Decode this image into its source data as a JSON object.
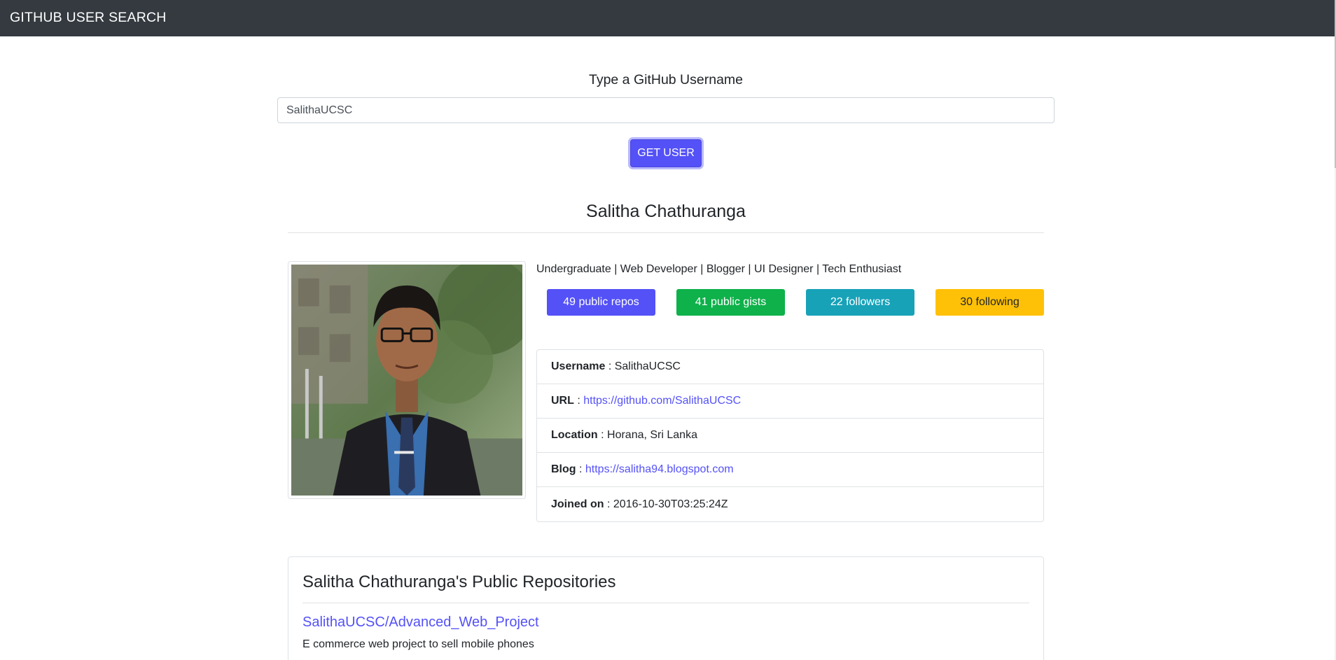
{
  "navbar": {
    "brand": "GITHUB USER SEARCH"
  },
  "search": {
    "title": "Type a GitHub Username",
    "value": "SalithaUCSC",
    "button_label": "GET USER"
  },
  "user": {
    "name": "Salitha Chathuranga",
    "bio": "Undergraduate | Web Developer | Blogger | UI Designer | Tech Enthusiast",
    "avatar_alt": "profile photo"
  },
  "stats": [
    {
      "label": "49 public repos",
      "bg": "#5451f7",
      "color": "#ffffff"
    },
    {
      "label": "41 public gists",
      "bg": "#0eb14a",
      "color": "#ffffff"
    },
    {
      "label": "22 followers",
      "bg": "#17a2b8",
      "color": "#ffffff"
    },
    {
      "label": "30 following",
      "bg": "#ffc107",
      "color": "#212529"
    }
  ],
  "details": [
    {
      "key": "Username",
      "sep": " : ",
      "value": "SalithaUCSC",
      "is_link": false
    },
    {
      "key": "URL",
      "sep": " : ",
      "value": "https://github.com/SalithaUCSC",
      "is_link": true
    },
    {
      "key": "Location",
      "sep": " : ",
      "value": "Horana, Sri Lanka",
      "is_link": false
    },
    {
      "key": "Blog",
      "sep": " : ",
      "value": "https://salitha94.blogspot.com",
      "is_link": true
    },
    {
      "key": "Joined on",
      "sep": " : ",
      "value": "2016-10-30T03:25:24Z",
      "is_link": false
    }
  ],
  "repos": {
    "heading": "Salitha Chathuranga's Public Repositories",
    "items": [
      {
        "name": "SalithaUCSC/Advanced_Web_Project",
        "description": "E commerce web project to sell mobile phones"
      }
    ]
  },
  "colors": {
    "navbar": "#343a40",
    "primary": "#5451f7",
    "success": "#0eb14a",
    "info": "#17a2b8",
    "warning": "#ffc107"
  }
}
